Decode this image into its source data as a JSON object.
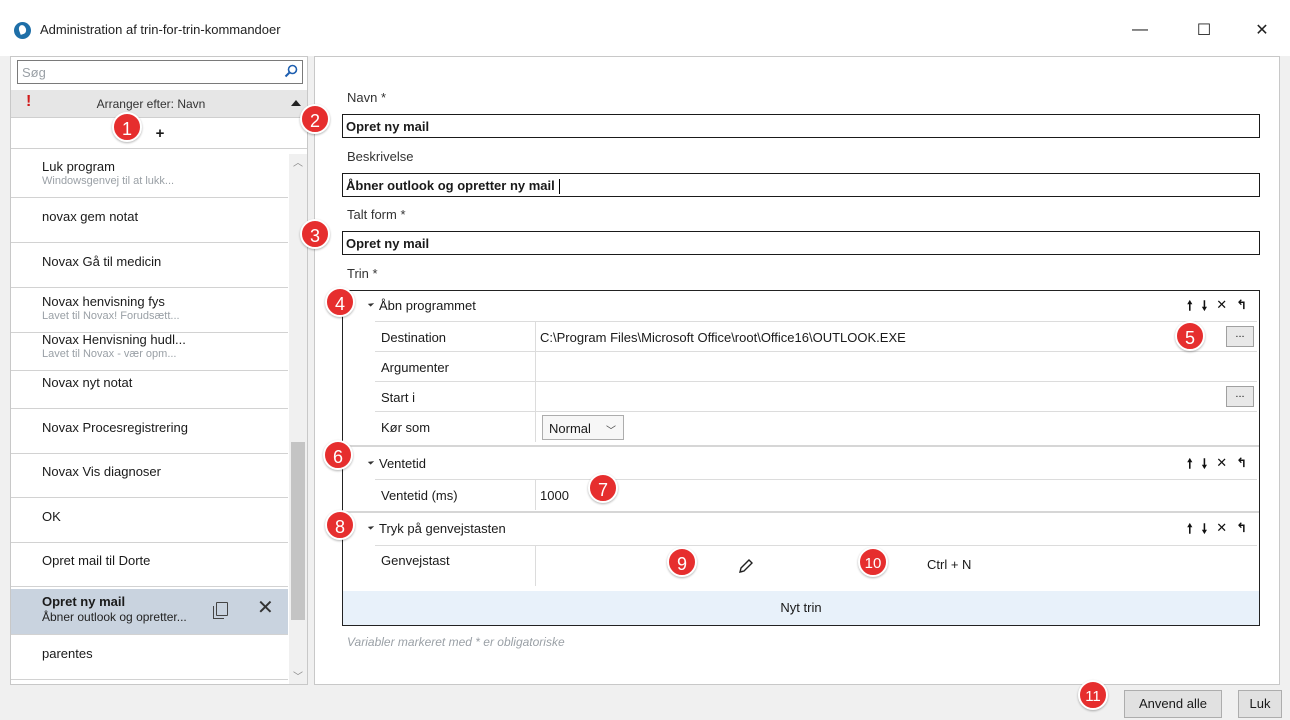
{
  "window": {
    "title": "Administration af trin-for-trin-kommandoer",
    "minimize": "—",
    "maximize": "☐",
    "close": "✕"
  },
  "sidebar": {
    "search_placeholder": "Søg",
    "warn": "!",
    "sort_label": "Arranger efter: Navn",
    "add_label": "+",
    "items": [
      {
        "title": "Luk program",
        "subtitle": "Windowsgenvej til at lukk..."
      },
      {
        "title": "novax gem notat",
        "subtitle": ""
      },
      {
        "title": "Novax Gå til medicin",
        "subtitle": ""
      },
      {
        "title": "Novax henvisning fys",
        "subtitle": "Lavet til Novax! Forudsætt..."
      },
      {
        "title": "Novax Henvisning hudl...",
        "subtitle": "Lavet til Novax - vær opm..."
      },
      {
        "title": "Novax nyt notat",
        "subtitle": ""
      },
      {
        "title": "Novax Procesregistrering",
        "subtitle": ""
      },
      {
        "title": "Novax Vis diagnoser",
        "subtitle": ""
      },
      {
        "title": "OK",
        "subtitle": ""
      },
      {
        "title": "Opret mail til Dorte",
        "subtitle": ""
      },
      {
        "title": "Opret ny mail",
        "subtitle": "Åbner outlook og opretter...",
        "selected": true
      },
      {
        "title": "parentes",
        "subtitle": ""
      }
    ]
  },
  "form": {
    "name_label": "Navn *",
    "name_value": "Opret ny mail",
    "desc_label": "Beskrivelse",
    "desc_value": "Åbner outlook og opretter ny mail",
    "spoken_label": "Talt form *",
    "spoken_value": "Opret ny mail",
    "steps_label": "Trin *",
    "hint": "Variabler markeret med * er obligatoriske"
  },
  "steps": {
    "tools": [
      "🠕",
      "🠗",
      "✕",
      "↰"
    ],
    "open": {
      "title": "Åbn programmet",
      "destination_label": "Destination",
      "destination_value": "C:\\Program Files\\Microsoft Office\\root\\Office16\\OUTLOOK.EXE",
      "arguments_label": "Argumenter",
      "arguments_value": "",
      "startin_label": "Start i",
      "startin_value": "",
      "runas_label": "Kør som",
      "runas_value": "Normal",
      "browse_label": "..."
    },
    "wait": {
      "title": "Ventetid",
      "label": "Ventetid (ms)",
      "value": "1000"
    },
    "hotkey": {
      "title": "Tryk på genvejstasten",
      "label": "Genvejstast",
      "value": "Ctrl + N"
    },
    "new_step": "Nyt trin"
  },
  "buttons": {
    "apply_all": "Anvend alle",
    "close": "Luk"
  },
  "badges": [
    "1",
    "2",
    "3",
    "4",
    "5",
    "6",
    "7",
    "8",
    "9",
    "10",
    "11"
  ],
  "colors": {
    "badge": "#e62e2e",
    "selected_row": "#c9d3df",
    "new_step_bg": "#e8f1fa",
    "app_icon": "#1e6fa8"
  }
}
